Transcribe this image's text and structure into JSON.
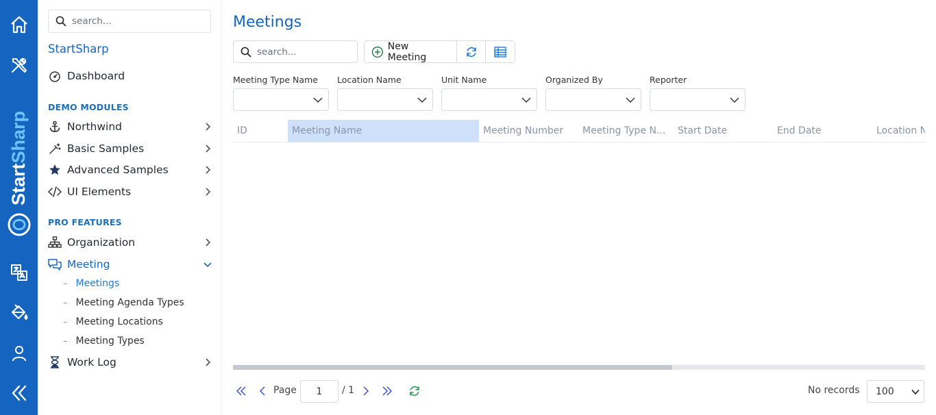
{
  "rail": {
    "brand": "StartSharp",
    "colors": {
      "background": "#1565c0",
      "icon": "#ffffff",
      "brand_light": "#6fc3ff"
    }
  },
  "sidebar": {
    "search_placeholder": "search...",
    "title": "StartSharp",
    "dashboard": {
      "label": "Dashboard",
      "icon": "gauge-icon"
    },
    "demo_section": "DEMO MODULES",
    "demo_items": [
      {
        "label": "Northwind",
        "icon": "anchor-icon"
      },
      {
        "label": "Basic Samples",
        "icon": "magic-wand-icon"
      },
      {
        "label": "Advanced Samples",
        "icon": "star-icon"
      },
      {
        "label": "UI Elements",
        "icon": "code-icon"
      }
    ],
    "pro_section": "PRO FEATURES",
    "pro_items": [
      {
        "label": "Organization",
        "icon": "sitemap-icon"
      },
      {
        "label": "Meeting",
        "icon": "chat-icon",
        "expanded": true
      },
      {
        "label": "Work Log",
        "icon": "hourglass-icon"
      }
    ],
    "meeting_children": [
      {
        "label": "Meetings",
        "active": true
      },
      {
        "label": "Meeting Agenda Types"
      },
      {
        "label": "Meeting Locations"
      },
      {
        "label": "Meeting Types"
      }
    ]
  },
  "main": {
    "title": "Meetings",
    "search_placeholder": "search...",
    "toolbar": {
      "new_label": "New Meeting"
    },
    "filters": [
      {
        "label": "Meeting Type Name"
      },
      {
        "label": "Location Name"
      },
      {
        "label": "Unit Name"
      },
      {
        "label": "Organized By"
      },
      {
        "label": "Reporter"
      }
    ],
    "columns": [
      {
        "label": "ID"
      },
      {
        "label": "Meeting Name",
        "selected": true
      },
      {
        "label": "Meeting Number"
      },
      {
        "label": "Meeting Type N..."
      },
      {
        "label": "Start Date"
      },
      {
        "label": "End Date"
      },
      {
        "label": "Location Name"
      }
    ],
    "pager": {
      "page_label": "Page",
      "page_value": "1",
      "total": "/ 1",
      "status": "No records",
      "page_size": "100"
    },
    "colors": {
      "accent": "#1565c0",
      "selected_header": "#cfe0fb",
      "refresh": "#2e9a5a"
    }
  }
}
